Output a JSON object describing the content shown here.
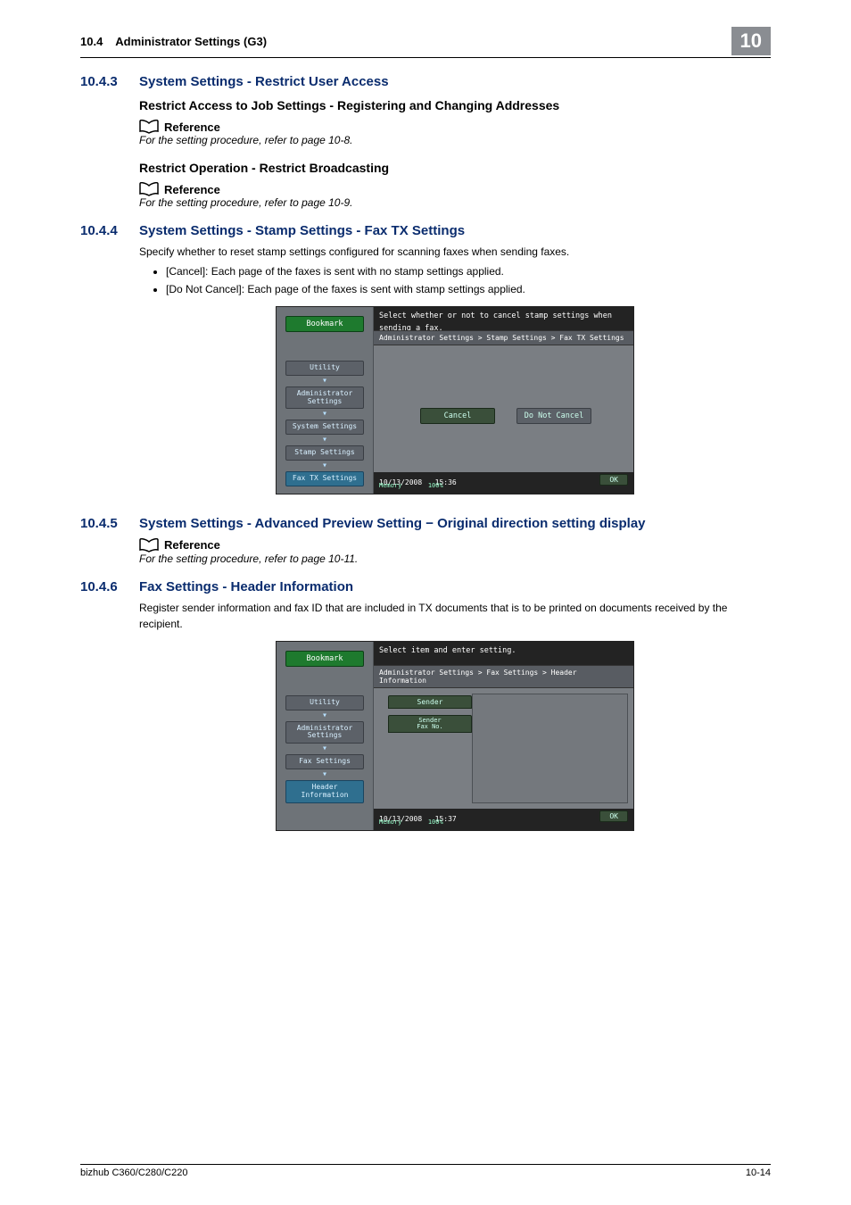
{
  "header": {
    "section_num": "10.4",
    "section_title": "Administrator Settings (G3)",
    "chapter": "10"
  },
  "s1": {
    "num": "10.4.3",
    "title": "System Settings - Restrict User Access",
    "sub1": "Restrict Access to Job Settings - Registering and Changing Addresses",
    "ref1_label": "Reference",
    "ref1_text": "For the setting procedure, refer to page 10-8.",
    "sub2": "Restrict Operation - Restrict Broadcasting",
    "ref2_label": "Reference",
    "ref2_text": "For the setting procedure, refer to page 10-9."
  },
  "s2": {
    "num": "10.4.4",
    "title": "System Settings - Stamp Settings - Fax TX Settings",
    "body": "Specify whether to reset stamp settings configured for scanning faxes when sending faxes.",
    "bul1": "[Cancel]: Each page of the faxes is sent with no stamp settings applied.",
    "bul2": "[Do Not Cancel]: Each page of the faxes is sent with stamp settings applied."
  },
  "fig1": {
    "instruction": "Select whether or not to cancel stamp settings when sending a fax.",
    "breadcrumb": "Administrator Settings > Stamp Settings > Fax TX Settings",
    "bookmark": "Bookmark",
    "nav": [
      "Utility",
      "Administrator\nSettings",
      "System Settings",
      "Stamp Settings",
      "Fax TX Settings"
    ],
    "cancel": "Cancel",
    "do_not_cancel": "Do Not Cancel",
    "date": "10/13/2008",
    "time": "15:36",
    "memory": "Memory",
    "mempct": "100%",
    "ok": "OK"
  },
  "s3": {
    "num": "10.4.5",
    "title": "System Settings - Advanced Preview Setting − Original direction setting display",
    "ref_label": "Reference",
    "ref_text": "For the setting procedure, refer to page 10-11."
  },
  "s4": {
    "num": "10.4.6",
    "title": "Fax Settings - Header Information",
    "body": "Register sender information and fax ID that are included in TX documents that is to be printed on documents received by the recipient."
  },
  "fig2": {
    "instruction": "Select item and enter setting.",
    "breadcrumb": "Administrator Settings  > Fax Settings  > Header Information",
    "bookmark": "Bookmark",
    "nav": [
      "Utility",
      "Administrator\nSettings",
      "Fax Settings",
      "Header\nInformation"
    ],
    "tab1": "Sender",
    "tab2": "Sender\nFax No.",
    "date": "10/13/2008",
    "time": "15:37",
    "memory": "Memory",
    "mempct": "100%",
    "ok": "OK"
  },
  "footer": {
    "left": "bizhub C360/C280/C220",
    "right": "10-14"
  }
}
